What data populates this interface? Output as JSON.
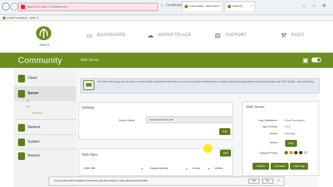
{
  "browser": {
    "back": "←",
    "forward": "→",
    "url": "https://192.168.1.103/webserver/...",
    "url_tools": "⌕ · Certificate error · C",
    "tabs": [
      {
        "label": "Community - Web Serv...",
        "close": "×"
      },
      {
        "label": "clearOS",
        "close": "×"
      }
    ],
    "window_icons": "⌂ ☆ ⚙",
    "favorites": "ClearFoundation - Web S..."
  },
  "header": {
    "logo_text": "clearOS",
    "nav": [
      {
        "label": "DASHBOARD",
        "icon": "monitor-icon",
        "glyph": "▭"
      },
      {
        "label": "MARKETPLACE",
        "icon": "cloud-icon",
        "glyph": "☁"
      },
      {
        "label": "SUPPORT",
        "icon": "inbox-icon",
        "glyph": "▤"
      },
      {
        "label": "ROOT",
        "icon": "wrench-icon",
        "glyph": "⚒"
      }
    ]
  },
  "greenbar": {
    "title": "Community",
    "page": "Web Server",
    "book_icon": "▣"
  },
  "sidebar": {
    "items": [
      {
        "label": "Cloud"
      },
      {
        "label": "Server"
      },
      {
        "label": "Network"
      },
      {
        "label": "System"
      },
      {
        "label": "Reports"
      }
    ],
    "sub": [
      "File",
      "Web",
      "Web Server"
    ]
  },
  "info": {
    "text": "The Web Server app can be used to create simple standalone web sites or as part of a broader infrastructure to deploy web-based applications using technologies like PHP, MySQL, and JavaScript."
  },
  "settings": {
    "title": "Settings",
    "server_name_label": "Server Name",
    "server_name_value": "community.test.com",
    "edit_label": "Edit"
  },
  "websites": {
    "title": "Web Sites",
    "add_label": "Add",
    "columns": [
      "Web Site",
      "Upload Access",
      "Group",
      "Action"
    ]
  },
  "webserver_panel": {
    "title": "Web Server",
    "rows": [
      {
        "label": "App Maintainer",
        "value": "ClearFoundation"
      },
      {
        "label": "App Version",
        "value": "2.5.0"
      },
      {
        "label": "Status",
        "value": "Running"
      },
      {
        "label": "Action",
        "value": ""
      },
      {
        "label": "Support Policy",
        "value": ""
      }
    ],
    "stop_label": "Stop",
    "policy_colors": [
      "#5c7d1a",
      "#d9a400",
      "#3b3b3b",
      "#3b3b3b",
      "#c9c9c9"
    ],
    "buttons": [
      "Details",
      "Uninstall",
      "Rate App"
    ]
  },
  "notification": {
    "text": "Do you want AutoComplete to remember web form entries?  Learn about AutoComplete",
    "yes": "Yes",
    "no": "No",
    "close": "×"
  }
}
